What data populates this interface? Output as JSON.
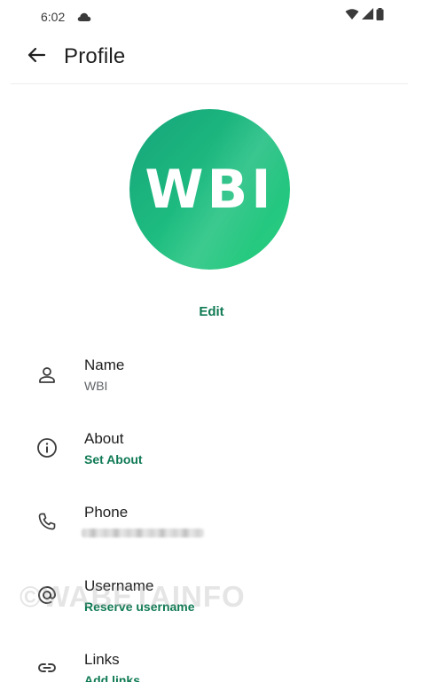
{
  "status_bar": {
    "time": "6:02",
    "icons": [
      "cloud-icon",
      "wifi-icon",
      "signal-icon",
      "battery-icon"
    ]
  },
  "toolbar": {
    "back_icon": "arrow-left-icon",
    "title": "Profile"
  },
  "avatar": {
    "initials": "WBI",
    "colors": [
      "#16a37a",
      "#2ad07f"
    ]
  },
  "edit_label": "Edit",
  "rows": [
    {
      "icon": "person-icon",
      "title": "Name",
      "subtitle": "WBI"
    },
    {
      "icon": "info-icon",
      "title": "About",
      "subtitle": "Set About"
    },
    {
      "icon": "phone-icon",
      "title": "Phone",
      "subtitle": ""
    },
    {
      "icon": "at-icon",
      "title": "Username",
      "subtitle": "Reserve username"
    },
    {
      "icon": "link-icon",
      "title": "Links",
      "subtitle": "Add links"
    }
  ],
  "colors": {
    "accent": "#0f7a54",
    "text": "#1f1f1f",
    "secondary": "#5f6368"
  },
  "watermark": "©WABETAINFO"
}
